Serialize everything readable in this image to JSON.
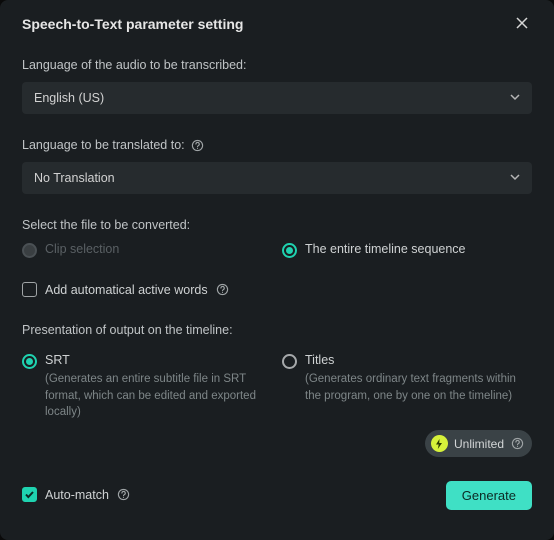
{
  "dialog": {
    "title": "Speech-to-Text parameter setting"
  },
  "audio_lang": {
    "label": "Language of the audio to be transcribed:",
    "value": "English (US)"
  },
  "translate_lang": {
    "label": "Language to be translated to:",
    "value": "No Translation"
  },
  "file_select": {
    "label": "Select the file to be converted:",
    "clip": "Clip selection",
    "timeline": "The entire timeline sequence"
  },
  "auto_words": {
    "label": "Add automatical active words"
  },
  "output": {
    "label": "Presentation of output on the timeline:",
    "srt": {
      "title": "SRT",
      "desc": "(Generates an entire subtitle file in SRT format, which can be edited and exported locally)"
    },
    "titles": {
      "title": "Titles",
      "desc": "(Generates ordinary text fragments within the program, one by one on the timeline)"
    }
  },
  "unlimited": "Unlimited",
  "auto_match": "Auto-match",
  "generate": "Generate"
}
